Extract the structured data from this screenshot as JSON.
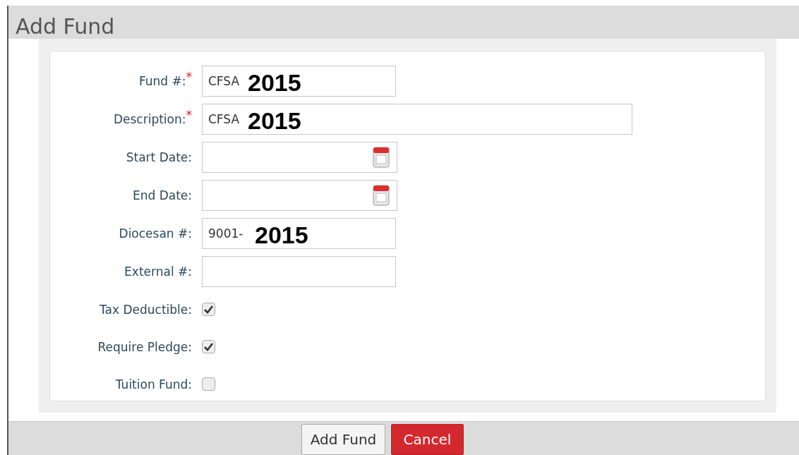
{
  "dialog": {
    "title": "Add Fund"
  },
  "fields": [
    {
      "kind": "text",
      "label": "Fund #:",
      "required_mark": "*",
      "value": "CFSA",
      "overlay": "2015"
    },
    {
      "kind": "wide_text",
      "label": "Description:",
      "required_mark": "*",
      "value": "CFSA",
      "overlay": "2015"
    },
    {
      "kind": "date",
      "label": "Start Date:"
    },
    {
      "kind": "date",
      "label": "End Date:"
    },
    {
      "kind": "text",
      "label": "Diocesan #:",
      "value": "9001-",
      "overlay": "2015"
    },
    {
      "kind": "text",
      "label": "External #:"
    }
  ],
  "checkboxes": [
    {
      "label": "Tax Deductible:",
      "checked": true
    },
    {
      "label": "Require Pledge:",
      "checked": true
    },
    {
      "label": "Tuition Fund:",
      "checked": false
    }
  ],
  "buttons": [
    {
      "label": "Add Fund",
      "kind": "default"
    },
    {
      "label": "Cancel",
      "kind": "danger"
    }
  ]
}
